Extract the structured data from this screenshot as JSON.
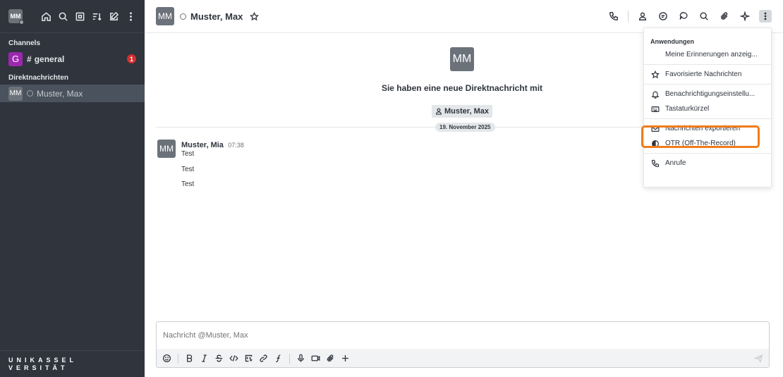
{
  "sidebar": {
    "user_avatar": "MM",
    "top_icons": [
      "home-icon",
      "search-icon",
      "directory-icon",
      "sort-icon",
      "create-new-icon",
      "more-vertical-icon"
    ],
    "section_channels": "Channels",
    "channel": {
      "avatar": "G",
      "name": "general",
      "unread": "1"
    },
    "section_dm": "Direktnachrichten",
    "dm": {
      "avatar": "MM",
      "name": "Muster, Max"
    },
    "logo_line1": "UNIKASSEL",
    "logo_line2": "VERSITÄT"
  },
  "header": {
    "avatar": "MM",
    "title": "Muster, Max",
    "action_icons": [
      "call-icon",
      "user-info-icon",
      "discussion-icon",
      "threads-icon",
      "search-icon",
      "files-icon",
      "apps-icon",
      "kebab-menu-icon"
    ]
  },
  "intro": {
    "avatar": "MM",
    "text": "Sie haben eine neue Direktnachricht mit",
    "user": "Muster, Max"
  },
  "date_divider": "19. November 2025",
  "message": {
    "avatar": "MM",
    "author": "Muster, Mia",
    "time": "07:38",
    "lines": [
      "Test",
      "Test",
      "Test"
    ]
  },
  "composer": {
    "placeholder": "Nachricht @Muster, Max"
  },
  "menu": {
    "heading": "Anwendungen",
    "items": [
      {
        "label": "Meine Erinnerungen anzeig...",
        "icon": ""
      },
      {
        "label": "Favorisierte Nachrichten",
        "icon": "star-icon"
      },
      {
        "label": "Benachrichtigungseinstellu...",
        "icon": "bell-icon"
      },
      {
        "label": "Tastaturkürzel",
        "icon": "keyboard-icon"
      },
      {
        "label": "Nachrichten exportieren",
        "icon": "mail-icon"
      },
      {
        "label": "OTR (Off-The-Record)",
        "icon": "otr-icon"
      },
      {
        "label": "Anrufe",
        "icon": "phone-icon"
      }
    ]
  },
  "colors": {
    "sidebar_bg": "#2f343d",
    "highlight": "#f07c1a",
    "channel_avatar": "#9c27b0",
    "badge": "#d32f2f"
  }
}
